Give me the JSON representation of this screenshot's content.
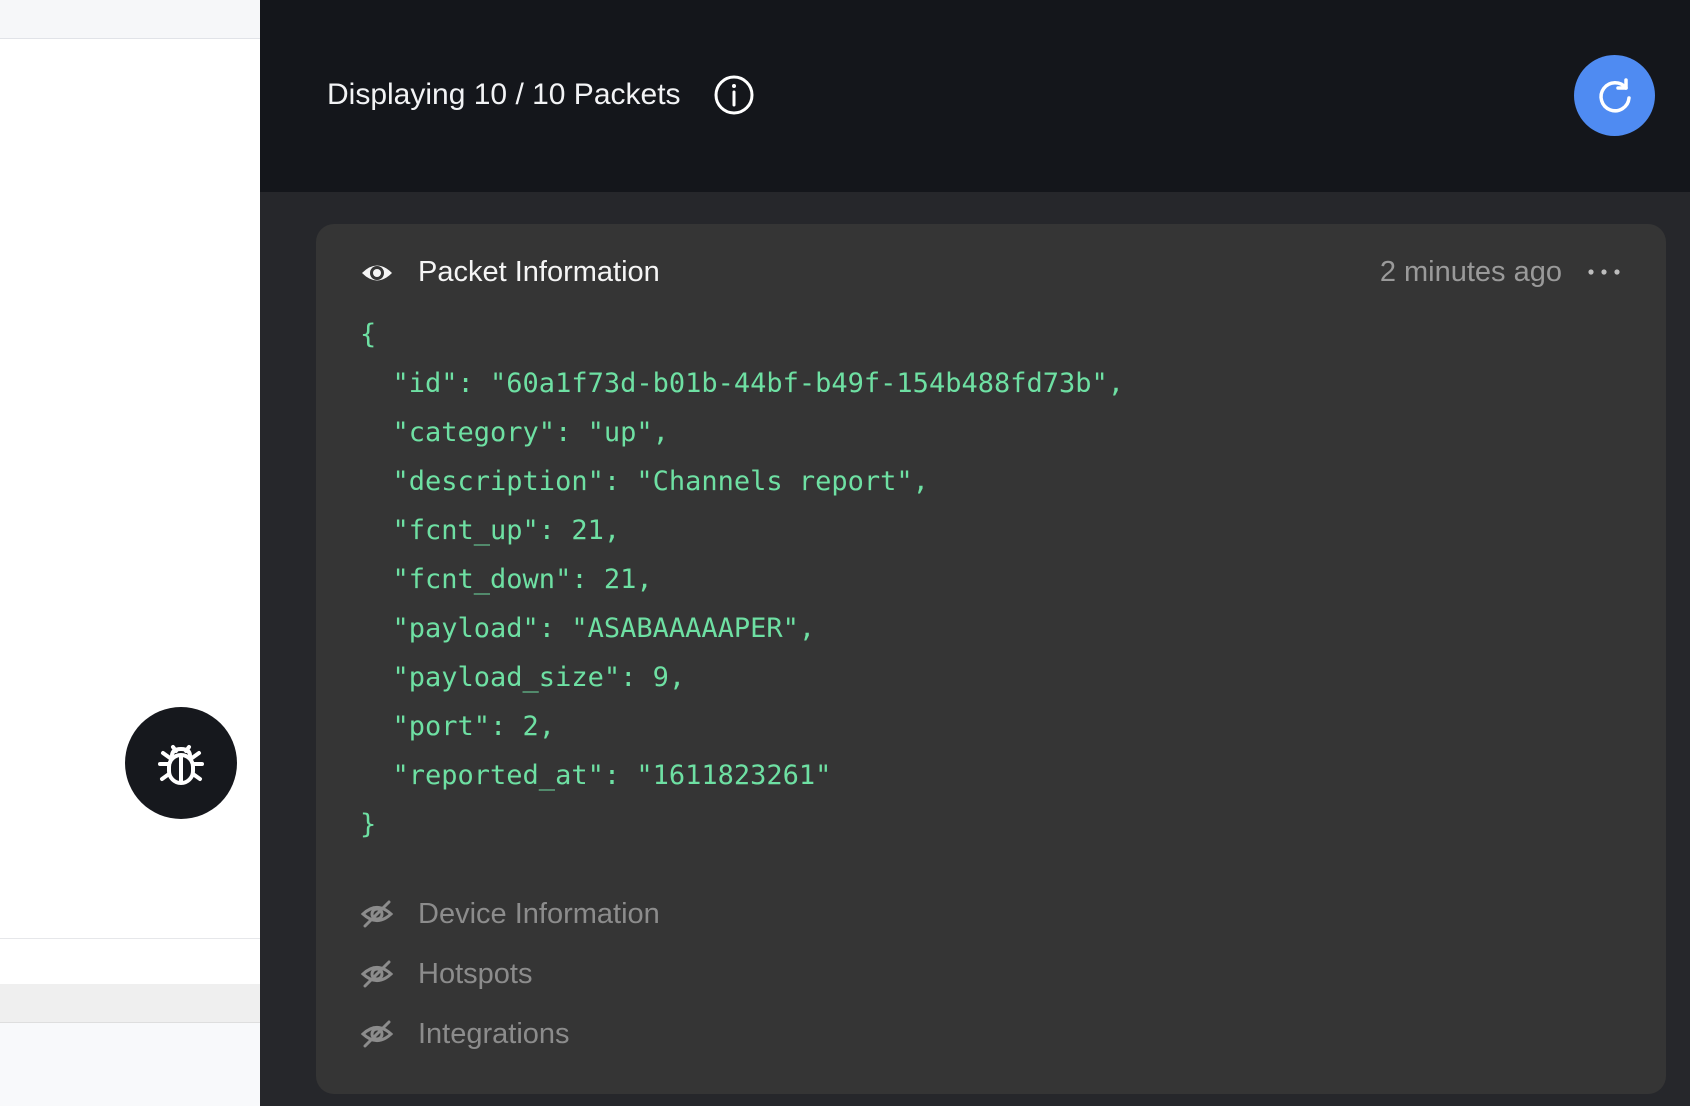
{
  "header": {
    "title": "Displaying 10 / 10 Packets",
    "info_icon": "info-circle-icon",
    "refresh_icon": "refresh-icon",
    "refresh_color": "#4f8bf2"
  },
  "debug_button": {
    "icon": "bug-icon"
  },
  "packet": {
    "title": "Packet Information",
    "time": "2 minutes ago",
    "title_icon": "eye-icon",
    "menu_icon": "more-horizontal-icon",
    "json_lines": [
      "{",
      "  \"id\": \"60a1f73d-b01b-44bf-b49f-154b488fd73b\",",
      "  \"category\": \"up\",",
      "  \"description\": \"Channels report\",",
      "  \"fcnt_up\": 21,",
      "  \"fcnt_down\": 21,",
      "  \"payload\": \"ASABAAAAAPER\",",
      "  \"payload_size\": 9,",
      "  \"port\": 2,",
      "  \"reported_at\": \"1611823261\"",
      "}"
    ],
    "json_color": "#6ee0a3"
  },
  "sections": [
    {
      "label": "Device Information",
      "icon": "eye-off-icon"
    },
    {
      "label": "Hotspots",
      "icon": "eye-off-icon"
    },
    {
      "label": "Integrations",
      "icon": "eye-off-icon"
    }
  ]
}
